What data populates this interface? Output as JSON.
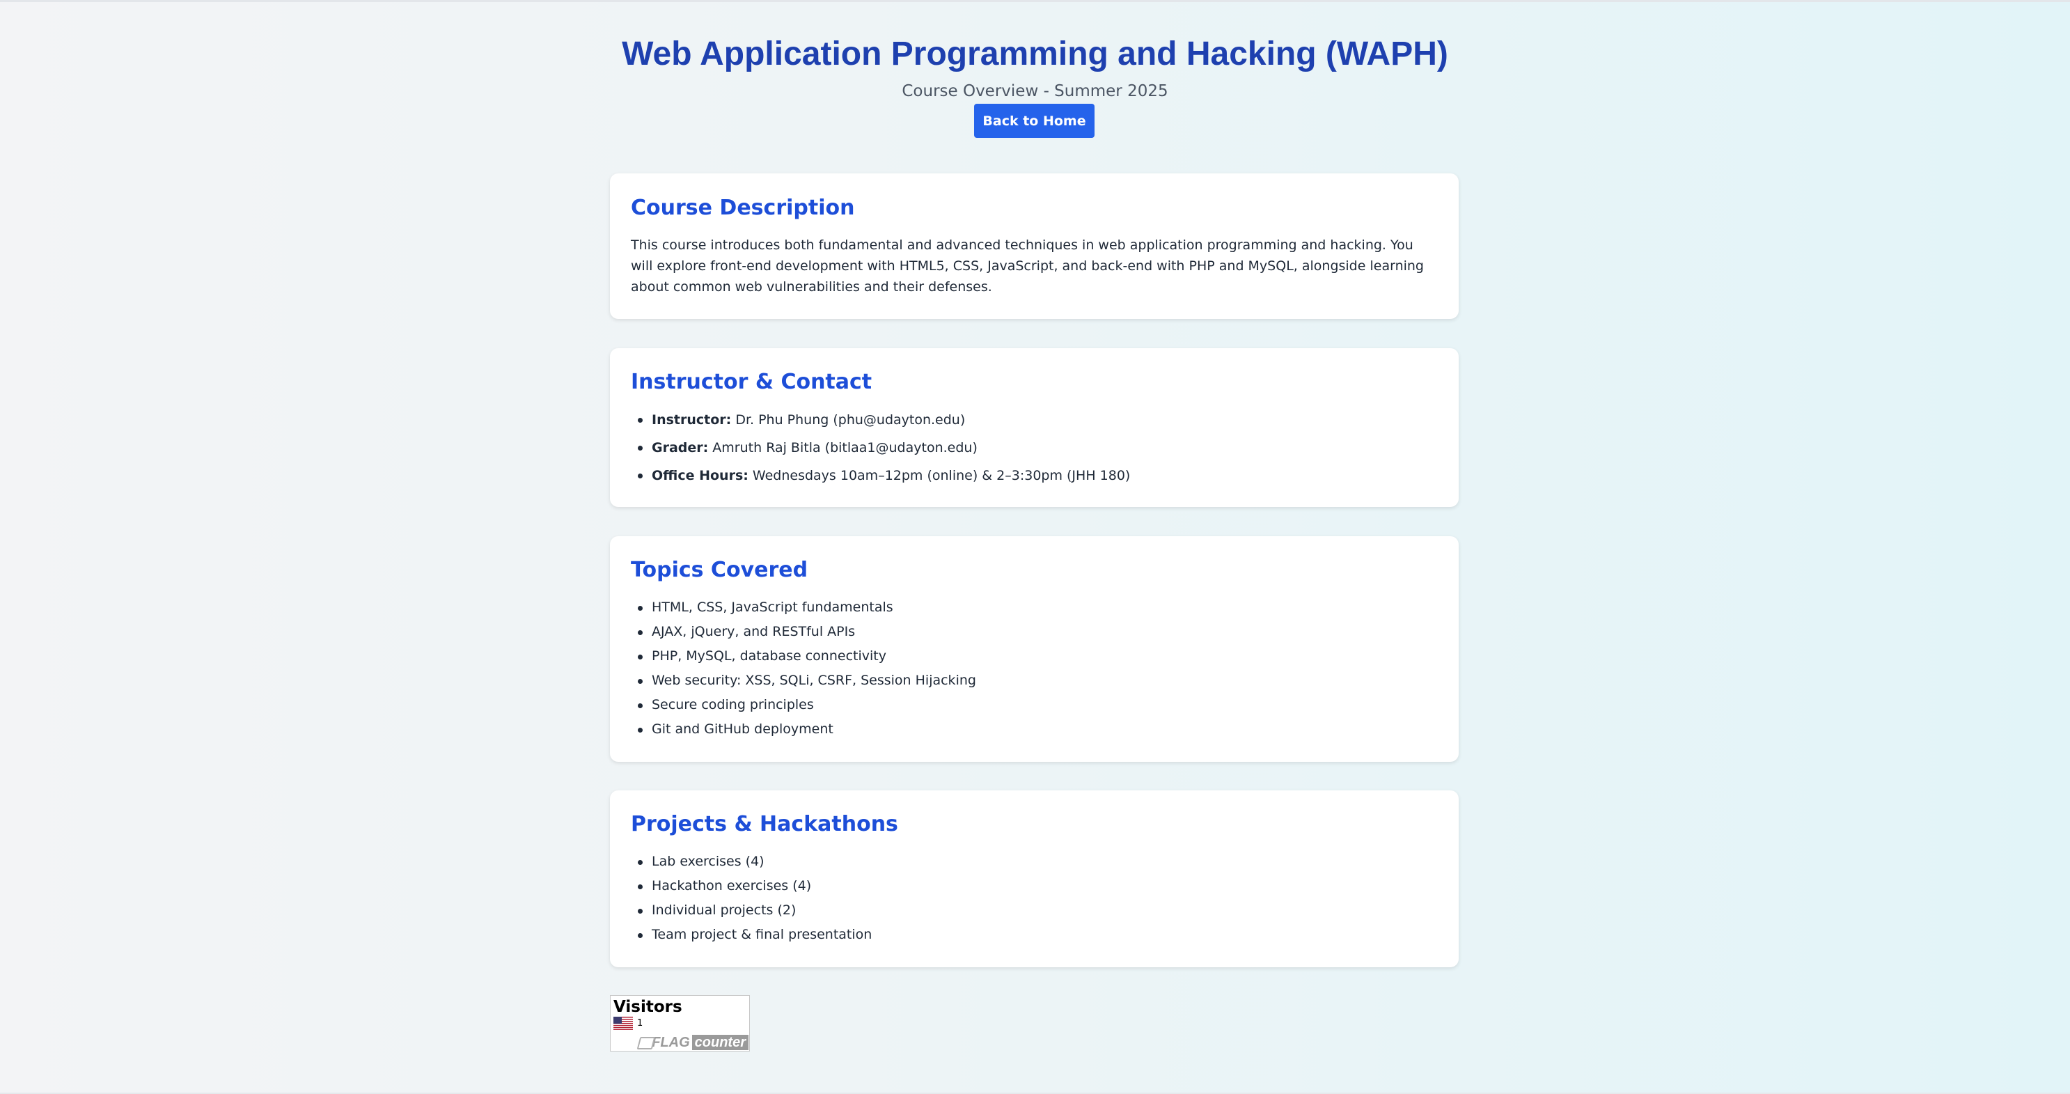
{
  "header": {
    "title": "Web Application Programming and Hacking (WAPH)",
    "subtitle": "Course Overview - Summer 2025",
    "back_button": "Back to Home"
  },
  "description": {
    "heading": "Course Description",
    "text": "This course introduces both fundamental and advanced techniques in web application programming and hacking. You will explore front-end development with HTML5, CSS, JavaScript, and back-end with PHP and MySQL, alongside learning about common web vulnerabilities and their defenses."
  },
  "instructor": {
    "heading": "Instructor & Contact",
    "items": [
      {
        "label": "Instructor:",
        "value": "Dr. Phu Phung (phu@udayton.edu)"
      },
      {
        "label": "Grader:",
        "value": "Amruth Raj Bitla (bitlaa1@udayton.edu)"
      },
      {
        "label": "Office Hours:",
        "value": "Wednesdays 10am–12pm (online) & 2–3:30pm (JHH 180)"
      }
    ]
  },
  "topics": {
    "heading": "Topics Covered",
    "items": [
      "HTML, CSS, JavaScript fundamentals",
      "AJAX, jQuery, and RESTful APIs",
      "PHP, MySQL, database connectivity",
      "Web security: XSS, SQLi, CSRF, Session Hijacking",
      "Secure coding principles",
      "Git and GitHub deployment"
    ]
  },
  "projects": {
    "heading": "Projects & Hackathons",
    "items": [
      "Lab exercises (4)",
      "Hackathon exercises (4)",
      "Individual projects (2)",
      "Team project & final presentation"
    ]
  },
  "visitors": {
    "title": "Visitors",
    "count": "1",
    "flag_icon": "us-flag-icon",
    "logo_flag": "FLAG",
    "logo_counter": "counter"
  },
  "colors": {
    "title": "#1e40af",
    "heading": "#1d4ed8",
    "button": "#2563eb"
  }
}
